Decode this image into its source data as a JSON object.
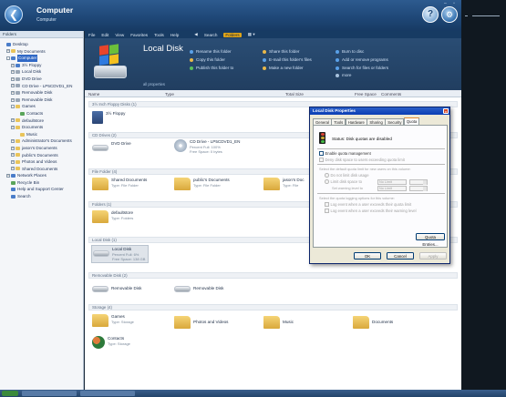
{
  "window": {
    "title": "Computer",
    "subtitle": "Computer"
  },
  "tree": {
    "header": "Folders",
    "nodes": [
      {
        "label": "Desktop",
        "indent": 0,
        "icon": "desktop-icon",
        "exp": ""
      },
      {
        "label": "My Documents",
        "indent": 1,
        "icon": "folder-icon",
        "exp": "+"
      },
      {
        "label": "Computer",
        "indent": 1,
        "icon": "computer-icon",
        "exp": "-",
        "selected": true
      },
      {
        "label": "3½ Floppy",
        "indent": 2,
        "icon": "floppy-icon",
        "exp": "+"
      },
      {
        "label": "Local Disk",
        "indent": 2,
        "icon": "drive-icon",
        "exp": "+"
      },
      {
        "label": "DVD Drive",
        "indent": 2,
        "icon": "dvd-icon",
        "exp": "+"
      },
      {
        "label": "CD Drive - LP5CDVD1_EN",
        "indent": 2,
        "icon": "cd-icon",
        "exp": "+"
      },
      {
        "label": "Removable Disk",
        "indent": 2,
        "icon": "drive-icon",
        "exp": "+"
      },
      {
        "label": "Removable Disk",
        "indent": 2,
        "icon": "drive-icon",
        "exp": "+"
      },
      {
        "label": "Games",
        "indent": 2,
        "icon": "folder-icon",
        "exp": "-"
      },
      {
        "label": "Contacts",
        "indent": 3,
        "icon": "contacts-icon",
        "exp": ""
      },
      {
        "label": "defaultstore",
        "indent": 2,
        "icon": "folder-icon",
        "exp": "+"
      },
      {
        "label": "Documents",
        "indent": 2,
        "icon": "folder-icon",
        "exp": "+"
      },
      {
        "label": "Music",
        "indent": 3,
        "icon": "music-icon",
        "exp": ""
      },
      {
        "label": "Administrator's Documents",
        "indent": 2,
        "icon": "folder-icon",
        "exp": "+"
      },
      {
        "label": "jason's Documents",
        "indent": 2,
        "icon": "folder-icon",
        "exp": "+"
      },
      {
        "label": "public's Documents",
        "indent": 2,
        "icon": "folder-icon",
        "exp": "+"
      },
      {
        "label": "Photos and Videos",
        "indent": 2,
        "icon": "folder-icon",
        "exp": "+"
      },
      {
        "label": "Shared Documents",
        "indent": 2,
        "icon": "folder-icon",
        "exp": "+"
      },
      {
        "label": "Network Places",
        "indent": 1,
        "icon": "network-icon",
        "exp": "+"
      },
      {
        "label": "Recycle Bin",
        "indent": 1,
        "icon": "recycle-bin-icon",
        "exp": ""
      },
      {
        "label": "Help and Support Center",
        "indent": 1,
        "icon": "help-icon",
        "exp": ""
      },
      {
        "label": "Search",
        "indent": 1,
        "icon": "search-icon",
        "exp": ""
      }
    ]
  },
  "cmdbar": [
    "File",
    "Edit",
    "View",
    "Favorites",
    "Tools",
    "Help",
    "Search",
    "Folders"
  ],
  "header": {
    "heading": "Local Disk",
    "see_properties": "all properties",
    "tasks": [
      {
        "label": "Rename this folder",
        "color": "#5aa0e8"
      },
      {
        "label": "Copy this folder",
        "color": "#e8b84a"
      },
      {
        "label": "Publish this folder to",
        "color": "#5ac05a"
      },
      {
        "label": "Share this folder",
        "color": "#e8b84a"
      },
      {
        "label": "E-mail this folder's files",
        "color": "#5aa0e8"
      },
      {
        "label": "Make a new folder",
        "color": "#e8b84a"
      },
      {
        "label": "Burn to disc",
        "color": "#5aa0e8"
      },
      {
        "label": "Add or remove programs",
        "color": "#5aa0e8"
      },
      {
        "label": "Search for files or folders",
        "color": "#5aa0e8"
      },
      {
        "label": "more",
        "color": "#a7c1dd"
      }
    ]
  },
  "columns": {
    "name": "Name",
    "type": "Type",
    "total": "Total Size",
    "free": "Free Space",
    "comments": "Comments"
  },
  "groups": [
    {
      "title": "3½ Inch Floppy Disks (1)"
    },
    {
      "title": "CD Drives (2)"
    },
    {
      "title": "File Folder (4)"
    },
    {
      "title": "Folders (1)"
    },
    {
      "title": "Local Disk (1)"
    },
    {
      "title": "Removable Disk (2)"
    },
    {
      "title": "Storage (4)"
    }
  ],
  "items": {
    "floppy": {
      "name": "3½ Floppy",
      "sub": ""
    },
    "dvd": {
      "name": "DVD Drive",
      "sub": ""
    },
    "cd": {
      "name": "CD Drive - LP5CDVD1_EN",
      "sub1": "Percent Full: 100%",
      "sub2": "Free Space: 0 bytes"
    },
    "shared": {
      "name": "Shared Documents",
      "sub": "Type: File Folder"
    },
    "publics": {
      "name": "public's Documents",
      "sub": "Type: File Folder"
    },
    "jasons": {
      "name": "jason's Doc",
      "sub": "Type: File"
    },
    "defaultstore": {
      "name": "defaultstore",
      "sub": "Type: Folders"
    },
    "localdisk": {
      "name": "Local Disk",
      "sub1": "Percent Full: 6%",
      "sub2": "Free Space: 138 GB"
    },
    "removable1": {
      "name": "Removable Disk"
    },
    "removable2": {
      "name": "Removable Disk"
    },
    "games": {
      "name": "Games",
      "sub": "Type: Storage"
    },
    "photos": {
      "name": "Photos and Videos"
    },
    "music": {
      "name": "Music"
    },
    "documents": {
      "name": "Documents"
    },
    "contacts": {
      "name": "Contacts",
      "sub": "Type: Storage"
    }
  },
  "dialog": {
    "title": "Local Disk Properties",
    "tabs": [
      "General",
      "Tools",
      "Hardware",
      "Sharing",
      "Security",
      "Quota"
    ],
    "active_tab": "Quota",
    "status": "Status:  Disk quotas are disabled",
    "enable_quota": "Enable quota management",
    "deny_space": "Deny disk space to users exceeding quota limit",
    "select_default": "Select the default quota limit for new users on this volume:",
    "no_limit": "Do not limit disk usage",
    "limit_to": "Limit disk space to",
    "warning_level": "Set warning level to",
    "no_limit_value": "No Limit",
    "select_logging": "Select the quota logging options for this volume:",
    "log_exceed_limit": "Log event when a user exceeds their quota limit",
    "log_exceed_warning": "Log event when a user exceeds their warning level",
    "quota_entries": "Quota Entries...",
    "ok": "OK",
    "cancel": "Cancel",
    "apply": "Apply"
  }
}
